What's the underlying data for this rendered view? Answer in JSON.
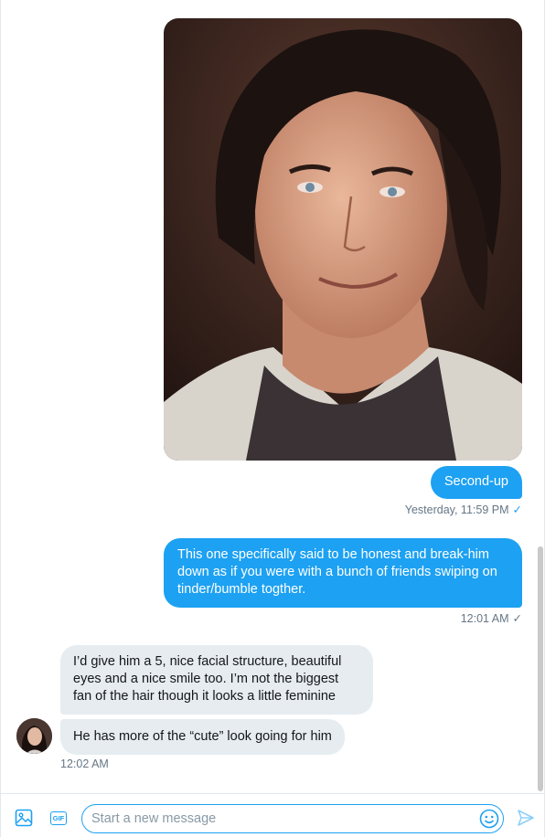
{
  "conversation": {
    "messages": [
      {
        "type": "image",
        "direction": "sent",
        "alt": ""
      },
      {
        "type": "text",
        "direction": "sent",
        "text": "Second-up"
      },
      {
        "type": "text",
        "direction": "sent",
        "text": "This one specifically said to be honest and break-him down as if you were with a bunch of friends swiping on tinder/bumble togther."
      },
      {
        "type": "text",
        "direction": "received",
        "text": "I’d give him a 5, nice facial structure, beautiful eyes and a nice smile too. I’m not the biggest fan of the hair though it looks a little feminine"
      },
      {
        "type": "text",
        "direction": "received",
        "text": "He has more of the “cute” look going for him"
      }
    ],
    "timestamps": {
      "first": "Yesterday, 11:59 PM",
      "second": "12:01 AM",
      "third": "12:02 AM"
    },
    "read_check": "✓"
  },
  "composer": {
    "placeholder": "Start a new message",
    "gif_label": "GIF",
    "icons": [
      "media-icon",
      "gif-icon",
      "emoji-icon",
      "send-icon"
    ]
  },
  "colors": {
    "accent": "#1da1f2",
    "received_bubble": "#e6ecf0",
    "timestamp": "#657786"
  }
}
